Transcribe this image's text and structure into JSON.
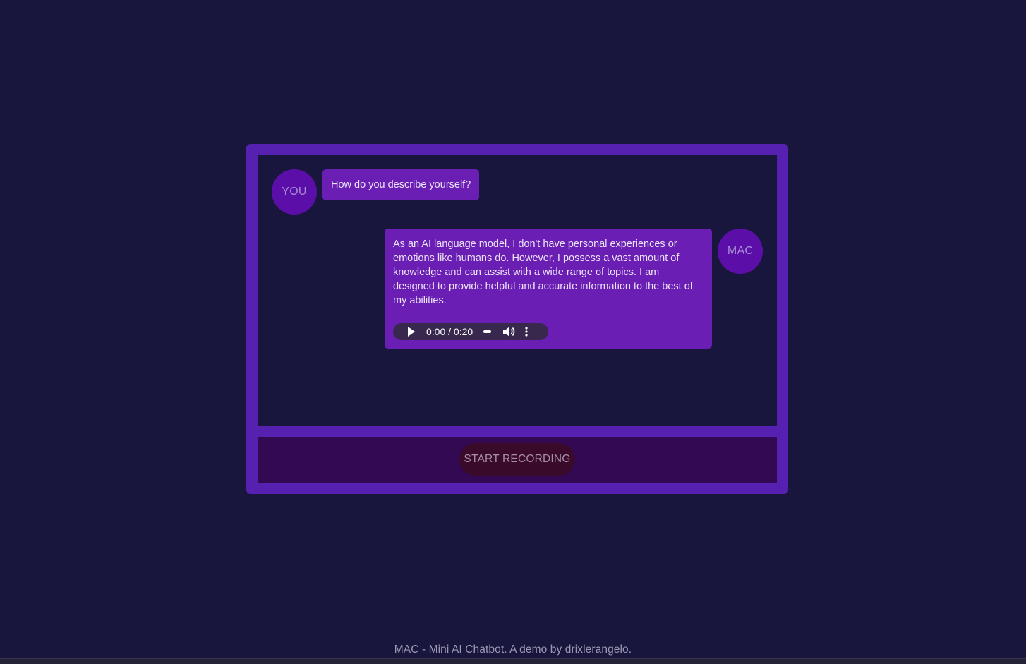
{
  "app": {
    "footer": "MAC - Mini AI Chatbot. A demo by drixlerangelo."
  },
  "chat": {
    "user": {
      "avatar_label": "YOU",
      "message": "How do you describe yourself?"
    },
    "bot": {
      "avatar_label": "MAC",
      "message": "As an AI language model, I don't have personal experiences or emotions like humans do. However, I possess a vast amount of knowledge and can assist with a wide range of topics. I am designed to provide helpful and accurate information to the best of my abilities.",
      "audio": {
        "time_display": "0:00 / 0:20",
        "progress": 0,
        "play_icon": "play-icon",
        "volume_icon": "volume-icon",
        "more_icon": "more-vertical-icon"
      }
    }
  },
  "controls": {
    "record_label": "START RECORDING"
  },
  "colors": {
    "background": "#19163d",
    "frame": "#5620b1",
    "bubble": "#6a1eb4",
    "avatar": "#5b0ea8",
    "control_bar": "#330954",
    "record_button": "#3a0a2a"
  }
}
